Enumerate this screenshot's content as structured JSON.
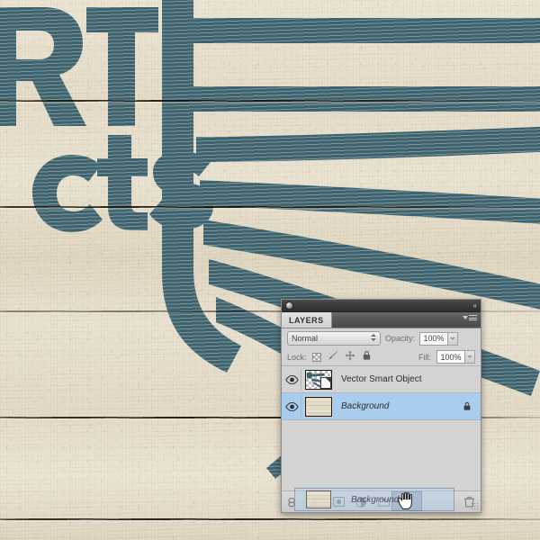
{
  "canvas": {
    "artwork_name": "vintage-wood-sign-artwork",
    "letters_left": "RT",
    "letters_lower": "cts",
    "ink_color": "#3d6370",
    "wood_color": "#e7e0cf"
  },
  "panel": {
    "title_bar": {
      "orb": "window-orb",
      "collapse_label": "«"
    },
    "tab_label": "LAYERS",
    "menu_icon": "panel-menu-icon",
    "blend": {
      "mode_label": "Normal",
      "opacity_label": "Opacity:",
      "opacity_value": "100%",
      "fill_label": "Fill:",
      "fill_value": "100%"
    },
    "lock": {
      "label": "Lock:",
      "icons": [
        "transparency-checker-icon",
        "brush-icon",
        "move-icon",
        "lock-icon"
      ]
    },
    "layers": [
      {
        "name": "Vector Smart Object",
        "visible": true,
        "selected": false,
        "locked": false,
        "thumb_type": "vector-smart-object",
        "italic": false
      },
      {
        "name": "Background",
        "visible": true,
        "selected": true,
        "locked": true,
        "thumb_type": "wood-photo",
        "italic": true
      }
    ],
    "bottom_tools": [
      "link-layers-icon",
      "layer-style-icon",
      "layer-mask-icon",
      "new-adjustment-layer-icon",
      "new-group-icon",
      "new-layer-icon",
      "delete-layer-icon"
    ],
    "drag": {
      "ghost_layer_name": "Background",
      "cursor": "grabbing-hand-cursor",
      "drop_target": "delete-layer-icon"
    },
    "resize_grip": "resize-grip"
  }
}
